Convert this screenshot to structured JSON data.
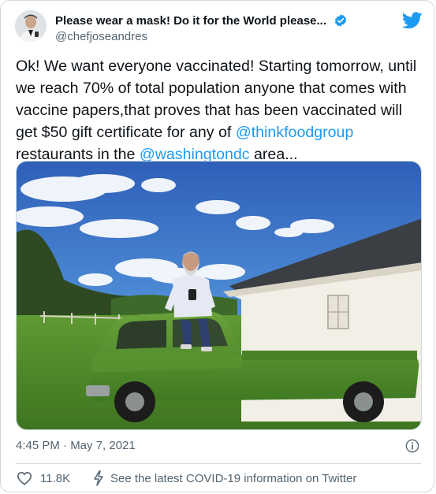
{
  "tweet": {
    "author": {
      "display_name": "Please wear a mask! Do it for the World please...",
      "handle": "@chefjoseandres",
      "verified": true,
      "avatar_icon": "avatar-photo"
    },
    "logo_icon": "twitter-bird-icon",
    "text": {
      "line1": "Ok! We want everyone vaccinated! Starting  tomorrow, until",
      "line2": "we reach 70% of total population anyone that comes with",
      "line3": "vaccine papers,that proves that has been vaccinated will",
      "line4_before": "get $50 gift certificate for any of ",
      "mention1": "@thinkfoodgroup",
      "line5_before": "restaurants in the ",
      "mention2": "@washingtondc",
      "line5_after": " area..."
    },
    "media": {
      "type": "photo"
    },
    "timestamp": "4:45 PM · May 7, 2021",
    "info_icon": "info-icon",
    "actions": {
      "like_count": "11.8K",
      "like_icon": "heart-icon",
      "covid_link": "See the latest COVID-19 information on Twitter",
      "covid_icon": "lightning-icon"
    },
    "colors": {
      "link": "#1d9bf0",
      "verified": "#1d9bf0",
      "secondary_text": "#536471",
      "truck_green": "#4e8a2a"
    }
  }
}
